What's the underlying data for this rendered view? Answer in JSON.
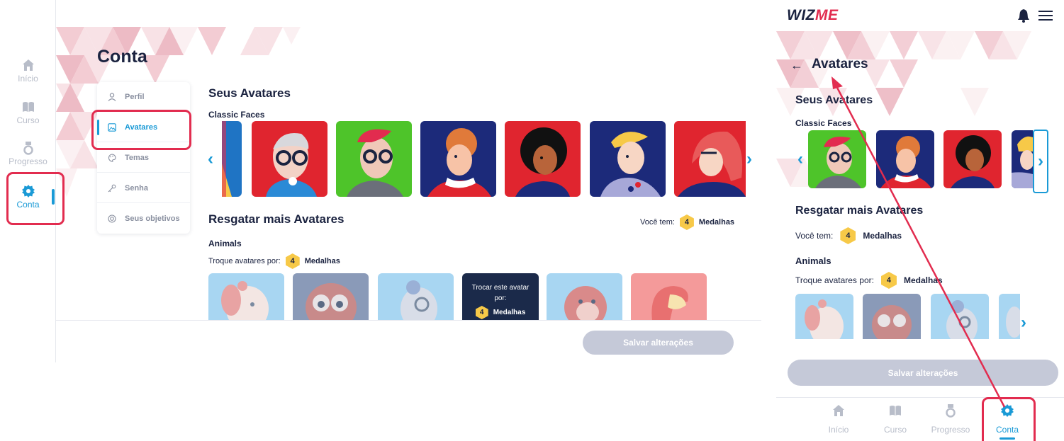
{
  "rail": {
    "items": [
      {
        "label": "Início",
        "icon": "home-icon"
      },
      {
        "label": "Curso",
        "icon": "book-icon"
      },
      {
        "label": "Progresso",
        "icon": "medal-icon"
      },
      {
        "label": "Conta",
        "icon": "gear-icon"
      }
    ]
  },
  "desktop": {
    "title": "Conta",
    "menu": [
      {
        "label": "Perfil",
        "icon": "user-icon"
      },
      {
        "label": "Avatares",
        "icon": "image-icon"
      },
      {
        "label": "Temas",
        "icon": "palette-icon"
      },
      {
        "label": "Senha",
        "icon": "key-icon"
      },
      {
        "label": "Seus objetivos",
        "icon": "target-icon"
      }
    ],
    "seus_avatares": "Seus Avatares",
    "classic_faces": "Classic Faces",
    "resgatar": "Resgatar mais Avatares",
    "voce_tem": "Você tem:",
    "medals_count": "4",
    "medalhas": "Medalhas",
    "animals": "Animals",
    "troque": "Troque avatares por:",
    "trade_line1": "Trocar este avatar",
    "trade_line2": "por:",
    "save": "Salvar alterações"
  },
  "mobile": {
    "logo_a": "WIZ",
    "logo_b": "ME",
    "title": "Avatares",
    "seus_avatares": "Seus Avatares",
    "classic_faces": "Classic Faces",
    "resgatar": "Resgatar mais Avatares",
    "voce_tem": "Você tem:",
    "medals_count": "4",
    "medalhas": "Medalhas",
    "animals": "Animals",
    "troque": "Troque avatares por:",
    "save": "Salvar alterações",
    "nav": [
      {
        "label": "Início",
        "icon": "home-icon"
      },
      {
        "label": "Curso",
        "icon": "book-icon"
      },
      {
        "label": "Progresso",
        "icon": "medal-icon"
      },
      {
        "label": "Conta",
        "icon": "gear-icon"
      }
    ]
  },
  "colors": {
    "accent": "#1a9ad6",
    "brand_red": "#e22c4f",
    "navy": "#1b2340",
    "medal": "#f7c948",
    "disabled_button": "#c5c9d8"
  }
}
